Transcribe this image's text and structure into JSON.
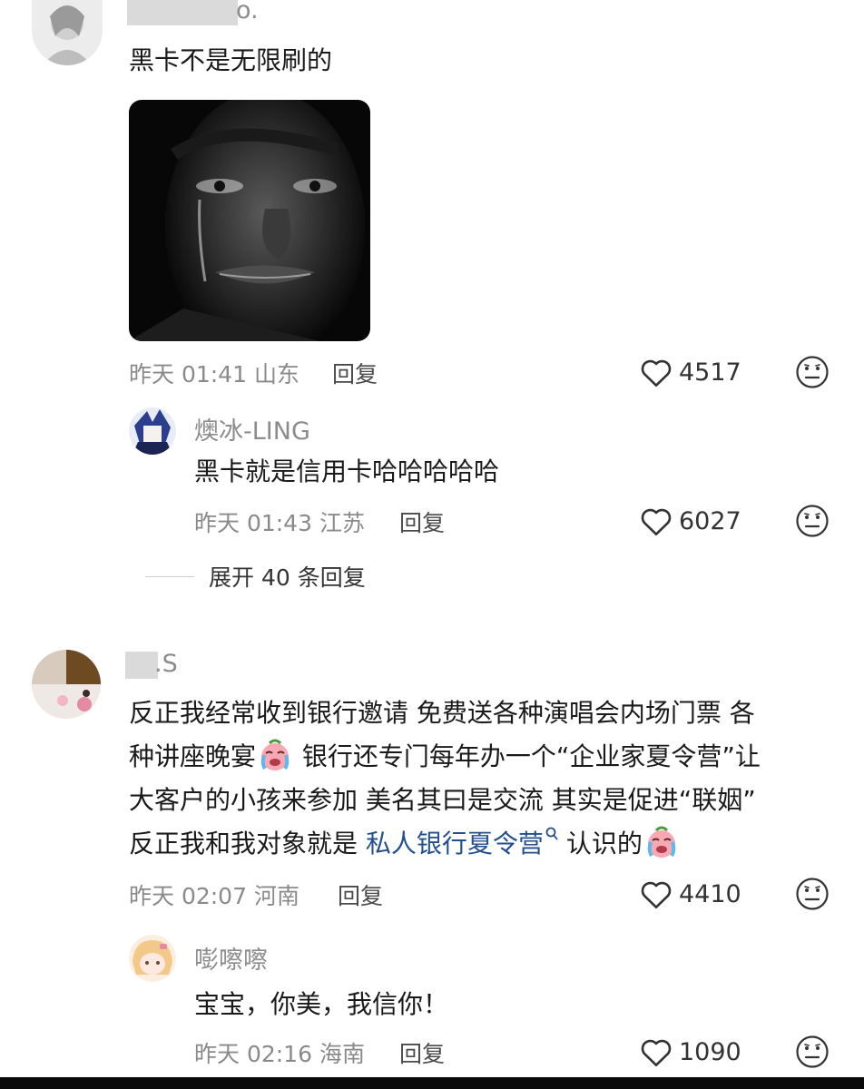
{
  "comments": [
    {
      "username": "o.",
      "text": "黑卡不是无限刷的",
      "time": "昨天 01:41",
      "location": "山东",
      "reply_label": "回复",
      "likes": "4517",
      "replies": [
        {
          "username": "燠冰-LING",
          "text": "黑卡就是信用卡哈哈哈哈哈",
          "time": "昨天 01:43",
          "location": "江苏",
          "reply_label": "回复",
          "likes": "6027"
        }
      ],
      "expand_label": "展开 40 条回复"
    },
    {
      "username": ".S",
      "text_lines": {
        "l1": "反正我经常收到银行邀请 免费送各种演唱会内场门票 各",
        "l2a": "种讲座晚宴",
        "l2b": " 银行还专门每年办一个“企业家夏令营”让",
        "l3": "大客户的小孩来参加 美名其曰是交流 其实是促进“联姻”",
        "l4a": "反正我和我对象就是 ",
        "l4_link": "私人银行夏令营",
        "l4b": " 认识的"
      },
      "time": "昨天 02:07",
      "location": "河南",
      "reply_label": "回复",
      "likes": "4410",
      "replies": [
        {
          "username": "嘭嚓嚓",
          "text": "宝宝，你美，我信你！",
          "time": "昨天 02:16",
          "location": "海南",
          "reply_label": "回复",
          "likes": "1090"
        }
      ]
    }
  ],
  "icons": {
    "like": "heart-outline-icon",
    "dislike": "neutral-face-icon",
    "search": "search-icon",
    "emoji": "crying-face-emoji"
  },
  "colors": {
    "keyword": "#244f8f",
    "meta": "#8a8a8a",
    "username": "#8c8c8c"
  }
}
